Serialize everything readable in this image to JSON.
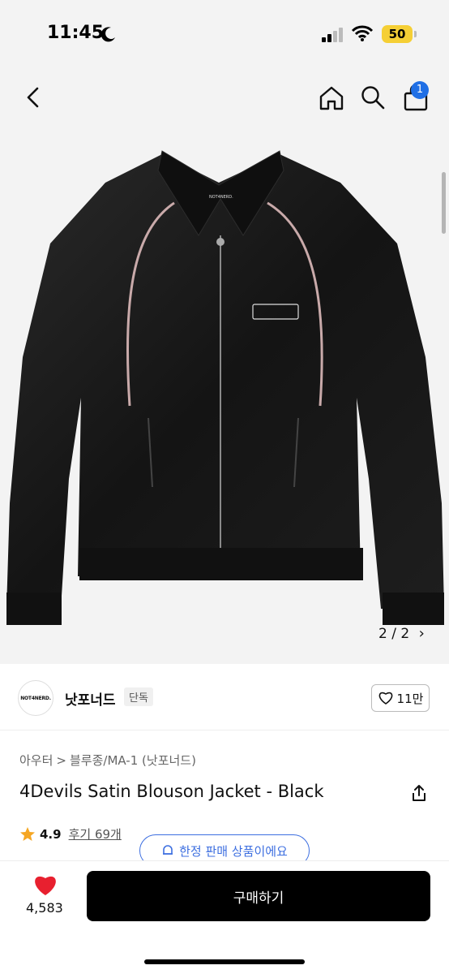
{
  "status": {
    "time": "11:45",
    "battery": "50"
  },
  "nav": {
    "cart_count": "1"
  },
  "gallery": {
    "pager": "2 / 2",
    "pager_arrow": "›",
    "jacket_label": "NOT4NERD."
  },
  "shop": {
    "logo_text": "NOT4NERD.",
    "name": "낫포너드",
    "tag": "단독",
    "likes": "11만"
  },
  "breadcrumb": {
    "category": "아우터",
    "separator": ">",
    "subcategory": "블루종/MA-1 (낫포너드)"
  },
  "product": {
    "title": "4Devils Satin Blouson Jacket - Black"
  },
  "rating": {
    "score": "4.9",
    "reviews": "후기 69개"
  },
  "banner": {
    "limited": "한정 판매 상품이에요"
  },
  "bottom": {
    "like_count": "4,583",
    "buy_label": "구매하기"
  },
  "colors": {
    "accent": "#1f6fe5",
    "heart": "#e8202f",
    "star": "#f5a623"
  }
}
